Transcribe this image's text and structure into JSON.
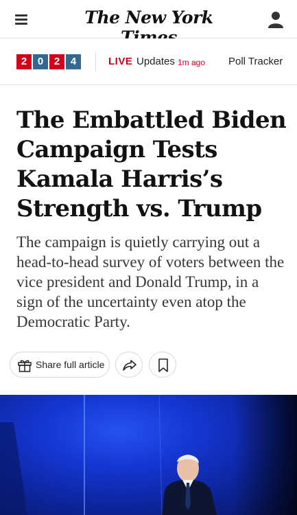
{
  "header": {
    "logo_text": "The New York Times",
    "menu_icon": "hamburger-menu-icon",
    "account_icon": "user-account-icon"
  },
  "election_bar": {
    "year_digits": [
      "2",
      "0",
      "2",
      "4"
    ],
    "year_colors": [
      "#d0021b",
      "#326891",
      "#d0021b",
      "#326891"
    ],
    "live_label": "LIVE",
    "updates_label": "Updates",
    "updated_ago": "1m ago",
    "poll_tracker_label": "Poll Tracker"
  },
  "article": {
    "headline": "The Embattled Biden Campaign Tests Kamala Harris’s Strength vs. Trump",
    "summary": "The campaign is quietly carrying out a head-to-head survey of voters between the vice president and Donald Trump, in a sign of the uncertainty even atop the Democratic Party."
  },
  "actions": {
    "share_full_article_label": "Share full article",
    "share_icon": "share-arrow-icon",
    "save_icon": "bookmark-icon",
    "gift_icon": "gift-icon"
  },
  "colors": {
    "live_red": "#d0021b",
    "year_blue": "#326891"
  }
}
